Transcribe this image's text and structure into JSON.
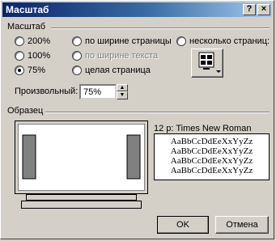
{
  "window": {
    "title": "Масштаб"
  },
  "titlebar": {
    "help_glyph": "?",
    "close_glyph": "×"
  },
  "zoom": {
    "group_label": "Масштаб",
    "options": [
      {
        "label": "200%",
        "selected": false,
        "enabled": true
      },
      {
        "label": "100%",
        "selected": false,
        "enabled": true
      },
      {
        "label": "75%",
        "selected": true,
        "enabled": true
      },
      {
        "label": "по ширине страницы",
        "selected": false,
        "enabled": true
      },
      {
        "label": "по ширине текста",
        "selected": false,
        "enabled": false
      },
      {
        "label": "целая страница",
        "selected": false,
        "enabled": true
      },
      {
        "label": "несколько страниц:",
        "selected": false,
        "enabled": true
      }
    ],
    "custom_label": "Произвольный:",
    "custom_value": "75%"
  },
  "preview": {
    "group_label": "Образец",
    "font_info": "12 p: Times New Roman",
    "sample_lines": [
      "AaBbCcDdEeXxYyZz",
      "AaBbCcDdEeXxYyZz",
      "AaBbCcDdEeXxYyZz",
      "AaBbCcDdEeXxYyZz"
    ]
  },
  "buttons": {
    "ok": "OK",
    "cancel": "Отмена"
  }
}
